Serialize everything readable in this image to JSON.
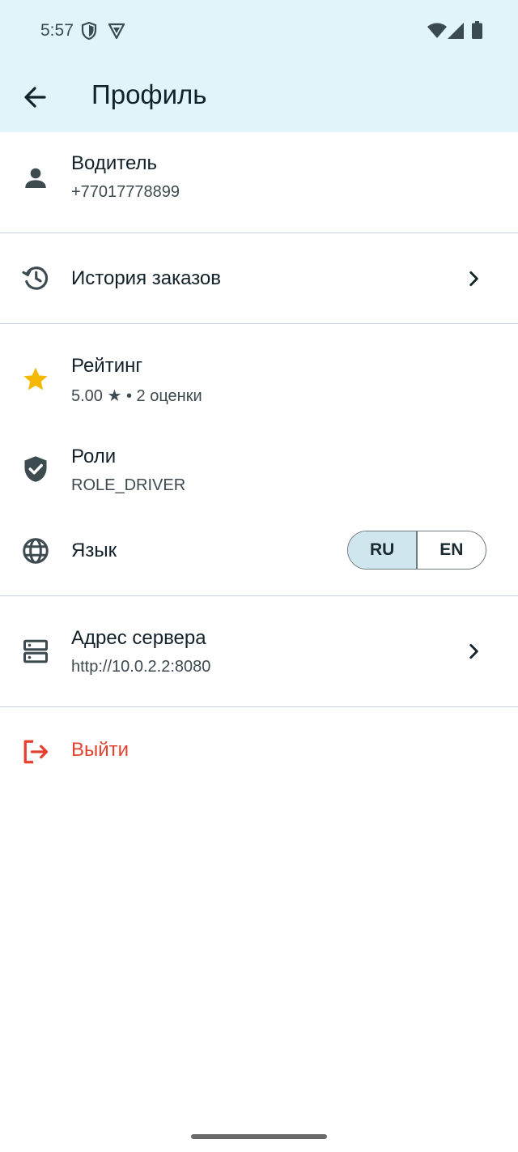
{
  "status_bar": {
    "time": "5:57"
  },
  "app_bar": {
    "title": "Профиль"
  },
  "profile": {
    "title": "Водитель",
    "phone": "+77017778899"
  },
  "order_history": {
    "label": "История заказов"
  },
  "rating": {
    "title": "Рейтинг",
    "value": "5.00 ★ • 2 оценки",
    "icon_color": "#f5b800"
  },
  "roles": {
    "title": "Роли",
    "value": "ROLE_DRIVER"
  },
  "language": {
    "title": "Язык",
    "options": [
      "RU",
      "EN"
    ],
    "selected": "RU"
  },
  "server": {
    "title": "Адрес сервера",
    "value": "http://10.0.2.2:8080"
  },
  "logout": {
    "label": "Выйти",
    "color": "#e5412f"
  },
  "colors": {
    "app_bar_bg": "#e0f4fa",
    "selected_toggle_bg": "#cfe6ee"
  }
}
